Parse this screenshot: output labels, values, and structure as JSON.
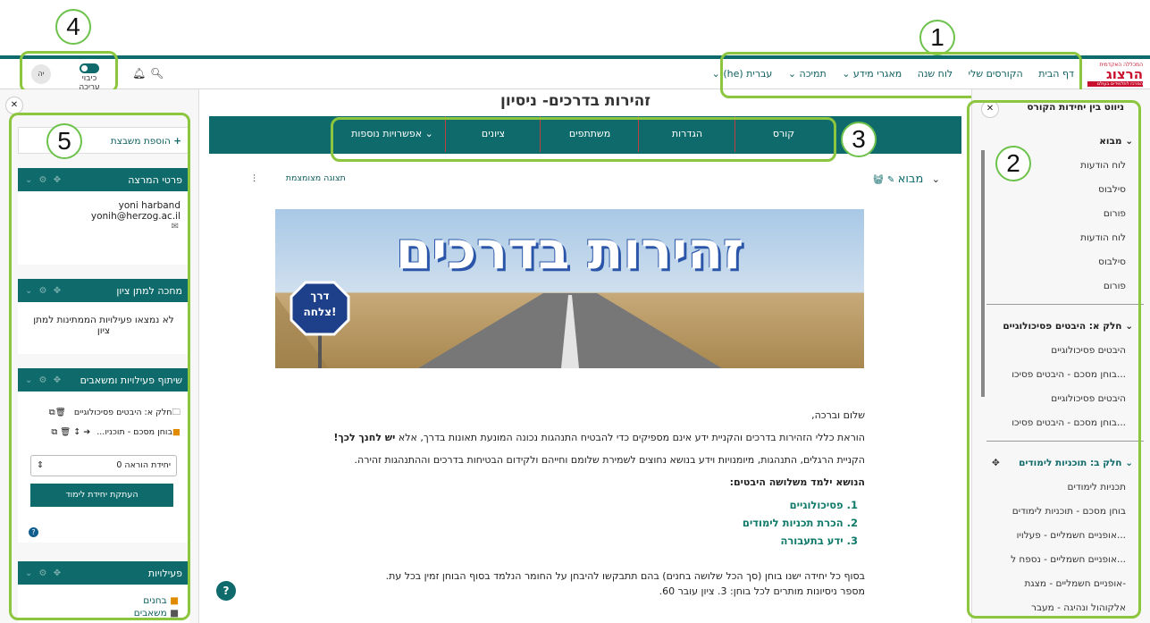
{
  "callouts": {
    "c1": "1",
    "c2": "2",
    "c3": "3",
    "c4": "4",
    "c5": "5"
  },
  "logo": {
    "line1": "המכללה האקדמית",
    "line2": "הרצוג",
    "line3": "המרכז לתלמידים בעולם"
  },
  "nav": {
    "home": "דף הבית",
    "my_courses": "הקורסים שלי",
    "calendar": "לוח שנה",
    "info": "מאגרי מידע",
    "support": "תמיכה",
    "language": "עברית (he)"
  },
  "editmode": {
    "label": "כיבוי עריכה",
    "user_initials": "יה"
  },
  "course": {
    "title": "זהירות בדרכים- ניסיון"
  },
  "tabs": [
    "קורס",
    "הגדרות",
    "משתתפים",
    "ציונים",
    "אפשרויות נוספות"
  ],
  "section": {
    "name": "מבוא",
    "collapsed_view": "תצוגה מצומצמת"
  },
  "banner": {
    "title": "זהירות בדרכים",
    "sign_line1": "דרך",
    "sign_line2": "צלחה!"
  },
  "content": {
    "greeting": "שלום וברכה,",
    "p1": "הוראת כללי הזהירות בדרכים והקניית ידע אינם מספיקים כדי להבטיח התנהגות נכונה המונעת תאונות בדרך, אלא",
    "p1_bold": "יש לחנך לכך!",
    "p2": "הקניית הרגלים, התנהגות, מיומנויות וידע בנושא נחוצים לשמירת שלומם וחייהם ולקידום הבטיחות בדרכים וההתנהגות זהירה.",
    "p3": "הנושא ילמד משלושה היבטים:",
    "items": [
      "1. פסיכולוגיים",
      "2. הכרת תכניות לימודים",
      "3. ידע בתעבורה"
    ],
    "p4": "בסוף כל יחידה ישנו בוחן (סך הכל שלושה בחנים) בהם תתבקשו להיבחן על החומר הנלמד בסוף הבוחן זמין בכל עת.",
    "p5": "מספר ניסיונות מותרים לכל בוחן: 3. ציון עובר 60."
  },
  "index": {
    "title": "ניווט בין יחידות הקורס",
    "sections": [
      {
        "name": "מבוא",
        "items": [
          "לוח הודעות",
          "סילבוס",
          "פורום",
          "לוח הודעות",
          "סילבוס",
          "פורום"
        ]
      },
      {
        "name": "חלק א: היבטים פסיכולוגיים",
        "items": [
          "היבטים פסיכולוגיים",
          "בוחן מסכם - היבטים פסיכו...",
          "היבטים פסיכולוגיים",
          "בוחן מסכם - היבטים פסיכו..."
        ]
      },
      {
        "name": "חלק ב: תוכניות לימודים",
        "items": [
          "תכניות לימודים",
          "בוחן מסכם - תוכניות לימודים",
          "אופניים חשמליים - פעלויו...",
          "אופניים חשמליים - נספח ל...",
          "אופניים חשמליים - מצגת-",
          "אלקוהול ונהיגה - מעבר"
        ]
      }
    ]
  },
  "leftpanel": {
    "add_block": "הוספת משבצת",
    "teacher": {
      "title": "פרטי המרצה",
      "name": "yoni harband",
      "email": "yonih@herzog.ac.il"
    },
    "grading": {
      "title": "מחכה למתן ציון",
      "text": "לא נמצאו פעילויות הממתינות למתן ציון"
    },
    "sharing": {
      "title": "שיתוף פעילויות ומשאבים",
      "item1": "חלק א: היבטים פסיכולוגיים",
      "item2": "בוחן מסכם - תוכניו...",
      "select_label": "יחידת הוראה 0",
      "copy_button": "העתקת יחידת לימוד"
    },
    "activities": {
      "title": "פעילויות",
      "item1": "בחנים",
      "item2": "משאבים"
    }
  },
  "colors": {
    "teal": "#0f6b6b",
    "green": "#8cc63f",
    "red": "#c8102e"
  }
}
